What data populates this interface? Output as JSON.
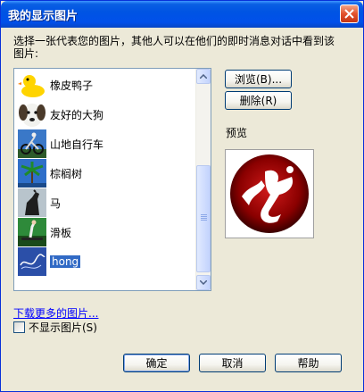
{
  "window": {
    "title": "我的显示图片"
  },
  "description": "选择一张代表您的图片，其他人可以在他们的即时消息对话中看到该图片:",
  "pictures": [
    {
      "label": "橡皮鸭子",
      "icon": "rubber-duck-icon"
    },
    {
      "label": "友好的大狗",
      "icon": "dog-icon"
    },
    {
      "label": "山地自行车",
      "icon": "mountain-bike-icon"
    },
    {
      "label": "棕榈树",
      "icon": "palm-tree-icon"
    },
    {
      "label": "马",
      "icon": "horse-icon"
    },
    {
      "label": "滑板",
      "icon": "skateboard-icon"
    },
    {
      "label": "hong",
      "icon": "custom-picture-icon",
      "selected": true
    }
  ],
  "buttons": {
    "browse": "浏览(B)...",
    "delete": "删除(R)",
    "ok": "确定",
    "cancel": "取消",
    "help": "帮助"
  },
  "preview": {
    "label": "预览"
  },
  "links": {
    "more_pictures": "下载更多的图片..."
  },
  "checkbox": {
    "label": "不显示图片(S)",
    "checked": false
  },
  "colors": {
    "titlebar": "#0054e3",
    "selection": "#316ac5",
    "link": "#0000ff",
    "dialog_bg": "#ece9d8"
  }
}
